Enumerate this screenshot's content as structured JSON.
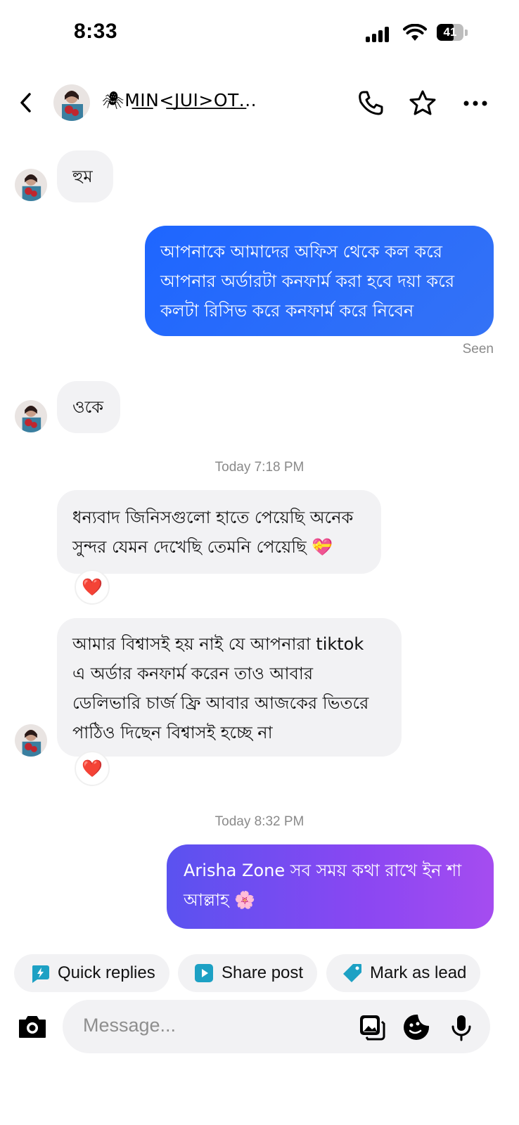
{
  "status_bar": {
    "time": "8:33",
    "battery": "41"
  },
  "header": {
    "contact_name": "🕷M͟I͟N<͟J͟U͟I͟>͟O͟T͟..."
  },
  "messages": [
    {
      "side": "in",
      "text": "হুম"
    },
    {
      "side": "out",
      "lines": [
        "আপনাকে আমাদের অফিস থেকে কল করে",
        "আপনার অর্ডারটা কনফার্ম করা হবে দয়া করে",
        "কলটা রিসিভ করে কনফার্ম করে নিবেন"
      ]
    },
    {
      "side": "in",
      "text": "ওকে"
    },
    {
      "side": "in",
      "lines": [
        "ধন্যবাদ জিনিসগুলো হাতে পেয়েছি অনেক",
        "সুন্দর যেমন দেখেছি তেমনি পেয়েছি 💝"
      ],
      "reaction": "❤️"
    },
    {
      "side": "in",
      "lines": [
        "আমার বিশ্বাসই হয় নাই যে আপনারা tiktok",
        "এ অর্ডার কনফার্ম করেন তাও আবার",
        "ডেলিভারি চার্জ ফ্রি আবার আজকের ভিতরে",
        "পাঠিও দিছেন বিশ্বাসই হচ্ছে না"
      ],
      "reaction": "❤️"
    },
    {
      "side": "out",
      "lines": [
        "Arisha Zone সব সময় কথা রাখে ইন শা",
        "আল্লাহ 🌸"
      ]
    }
  ],
  "seen_label": "Seen",
  "timestamps": [
    "Today 7:18 PM",
    "Today 8:32 PM"
  ],
  "chips": {
    "quick_replies": "Quick replies",
    "share_post": "Share post",
    "mark_as_lead": "Mark as lead"
  },
  "composer": {
    "placeholder": "Message..."
  },
  "colors": {
    "outgoing": "#2d6bf2",
    "outgoing_gradient_end": "#a54cf0",
    "incoming": "#f2f2f4",
    "chip_icon": "#1da1c4"
  }
}
